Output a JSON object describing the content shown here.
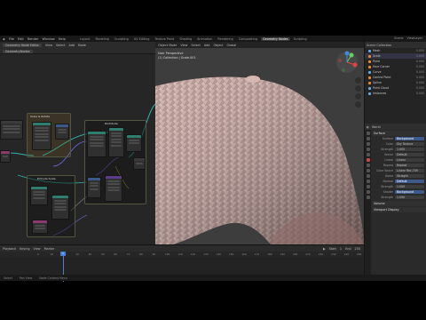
{
  "topbar": {
    "menus": [
      "File",
      "Edit",
      "Render",
      "Window",
      "Help"
    ],
    "workspaces": [
      "Layout",
      "Modeling",
      "Sculpting",
      "UV Editing",
      "Texture Paint",
      "Shading",
      "Animation",
      "Rendering",
      "Compositing",
      "Geometry Nodes",
      "Scripting"
    ],
    "active_workspace": "Geometry Nodes",
    "scene_label": "Scene",
    "viewlayer_label": "ViewLayer"
  },
  "node_editor": {
    "editor_type": "Geometry Node Editor",
    "modifier_name": "GeometryNodes",
    "frames": [
      "Scale & Rotate",
      "Distribute",
      "Extrude Scale"
    ],
    "header_menus": [
      "View",
      "Select",
      "Add",
      "Node"
    ]
  },
  "viewport": {
    "mode": "Object Mode",
    "header_menus": [
      "View",
      "Select",
      "Add",
      "Object"
    ],
    "view_name": "User Perspective",
    "collection_info": "(1) Collection | Scale.001",
    "gizmo_axes": [
      "X",
      "Y",
      "Z"
    ],
    "shading": "Global"
  },
  "outliner": {
    "title": "Scene Collection",
    "items": [
      {
        "label": "Mesh",
        "value": "0.000"
      },
      {
        "label": "Scale",
        "value": "0.000"
      },
      {
        "label": "Point",
        "value": "0.000"
      },
      {
        "label": "Face Corner",
        "value": "0.000"
      },
      {
        "label": "Curve",
        "value": "0.000"
      },
      {
        "label": "Control Point",
        "value": "0.000"
      },
      {
        "label": "Spline",
        "value": "0.000"
      },
      {
        "label": "Point Cloud",
        "value": "0.000"
      },
      {
        "label": "Instances",
        "value": "0.000"
      }
    ]
  },
  "properties": {
    "object_name": "World",
    "sections": {
      "surface": "Surface",
      "volume": "Volume",
      "viewport_display": "Viewport Display"
    },
    "rows": [
      {
        "label": "Surface",
        "value": "Background",
        "highlight": true
      },
      {
        "label": "Color",
        "value": "Sky Texture",
        "highlight": false
      },
      {
        "label": "Strength",
        "value": "1.000",
        "highlight": false
      },
      {
        "label": "Vector",
        "value": "Default",
        "highlight": false
      },
      {
        "label": "Linear",
        "value": "Linear",
        "highlight": false
      },
      {
        "label": "Repeat",
        "value": "Repeat",
        "highlight": false
      },
      {
        "label": "Color Space",
        "value": "Linear Rec.709",
        "highlight": false
      },
      {
        "label": "Alpha",
        "value": "Straight",
        "highlight": false
      },
      {
        "label": "Normal",
        "value": "Default",
        "highlight": true
      },
      {
        "label": "Strength",
        "value": "1.000",
        "highlight": false
      },
      {
        "label": "Shader",
        "value": "Background",
        "highlight": true
      },
      {
        "label": "Strength",
        "value": "1.000",
        "highlight": false
      }
    ]
  },
  "timeline": {
    "header": [
      "Playback",
      "Keying",
      "View",
      "Marker"
    ],
    "ticks": [
      "0",
      "10",
      "20",
      "30",
      "40",
      "50",
      "60",
      "70",
      "80",
      "90",
      "100",
      "110",
      "120",
      "130",
      "140",
      "150",
      "160",
      "170",
      "180",
      "190",
      "200",
      "210",
      "220",
      "230",
      "240",
      "250"
    ],
    "current_frame": "1",
    "start": "1",
    "end": "250"
  },
  "status": [
    "Select",
    "Pan View",
    "Node Context Menu"
  ],
  "colors": {
    "accent": "#4a7fd8",
    "skin": "#c9a7a2",
    "frame_orange": "#e38d3b"
  }
}
